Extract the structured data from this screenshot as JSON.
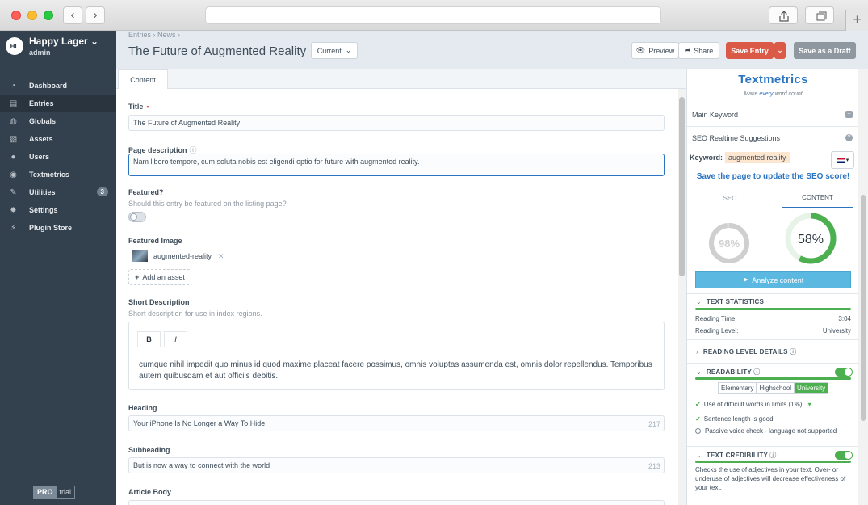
{
  "browser": {
    "back": "‹",
    "forward": "›",
    "new_tab": "+"
  },
  "sidebar": {
    "brand_logo": "HL",
    "brand_name": "Happy Lager",
    "user": "admin",
    "items": [
      {
        "label": "Dashboard",
        "icon": "dashboard-icon",
        "active": false
      },
      {
        "label": "Entries",
        "icon": "entries-icon",
        "active": true
      },
      {
        "label": "Globals",
        "icon": "globe-icon",
        "active": false
      },
      {
        "label": "Assets",
        "icon": "image-icon",
        "active": false
      },
      {
        "label": "Users",
        "icon": "users-icon",
        "active": false
      },
      {
        "label": "Textmetrics",
        "icon": "textmetrics-icon",
        "active": false
      },
      {
        "label": "Utilities",
        "icon": "wrench-icon",
        "active": false,
        "badge": "3"
      },
      {
        "label": "Settings",
        "icon": "gear-icon",
        "active": false
      },
      {
        "label": "Plugin Store",
        "icon": "plug-icon",
        "active": false
      }
    ],
    "pro": "PRO",
    "trial": "trial"
  },
  "header": {
    "breadcrumb": "Entries › News ›",
    "title": "The Future of Augmented Reality",
    "revision": "Current",
    "preview": "Preview",
    "share": "Share",
    "save_entry": "Save Entry",
    "save_draft": "Save as a Draft"
  },
  "tabs": {
    "content": "Content"
  },
  "form": {
    "title_label": "Title",
    "title_value": "The Future of Augmented Reality",
    "desc_label": "Page description",
    "desc_value": "Nam libero tempore, cum soluta nobis est eligendi optio for future with augmented reality.",
    "featured_label": "Featured?",
    "featured_help": "Should this entry be featured on the listing page?",
    "image_label": "Featured Image",
    "image_name": "augmented-reality",
    "add_asset": "Add an asset",
    "short_label": "Short Description",
    "short_help": "Short description for use in index regions.",
    "rte_bold": "B",
    "rte_italic": "I",
    "short_text": "cumque nihil impedit quo minus id quod maxime placeat facere possimus, omnis voluptas assumenda est, omnis dolor repellendus. Temporibus autem quibusdam et aut officiis debitis.",
    "heading_label": "Heading",
    "heading_value": "Your iPhone Is No Longer a Way To Hide",
    "heading_count": "217",
    "sub_label": "Subheading",
    "sub_value": "But is now a way to connect with the world",
    "sub_count": "213",
    "body_label": "Article Body"
  },
  "panel": {
    "logo": "Textmetrics",
    "tag_pre": "Make ",
    "tag_em": "every",
    "tag_post": " word count",
    "main_keyword": "Main Keyword",
    "seo_realtime": "SEO Realtime Suggestions",
    "keyword_label": "Keyword:",
    "keyword_value": "augmented reality",
    "save_msg": "Save the page to update the SEO score!",
    "tab_seo": "SEO",
    "tab_content": "CONTENT",
    "seo_score": 98,
    "content_score": 58,
    "seo_score_text": "98%",
    "content_score_text": "58%",
    "analyze": "Analyze content",
    "text_stats": "TEXT STATISTICS",
    "reading_time_label": "Reading Time:",
    "reading_time": "3:04",
    "reading_level_label": "Reading Level:",
    "reading_level": "University",
    "reading_level_details": "READING LEVEL DETAILS",
    "readability": "READABILITY",
    "levels": [
      "Elementary",
      "Highschool",
      "University"
    ],
    "check1": "Use of difficult words in limits (1%).",
    "check2": "Sentence length is good.",
    "check3": "Passive voice check - language not supported",
    "credibility": "TEXT CREDIBILITY",
    "credibility_text": "Checks the use of adjectives in your text. Over- or underuse of adjectives will decrease effectiveness of your text.",
    "colors": {
      "accent": "#2b74c2",
      "success": "#4caf50",
      "danger": "#da5a47"
    }
  }
}
